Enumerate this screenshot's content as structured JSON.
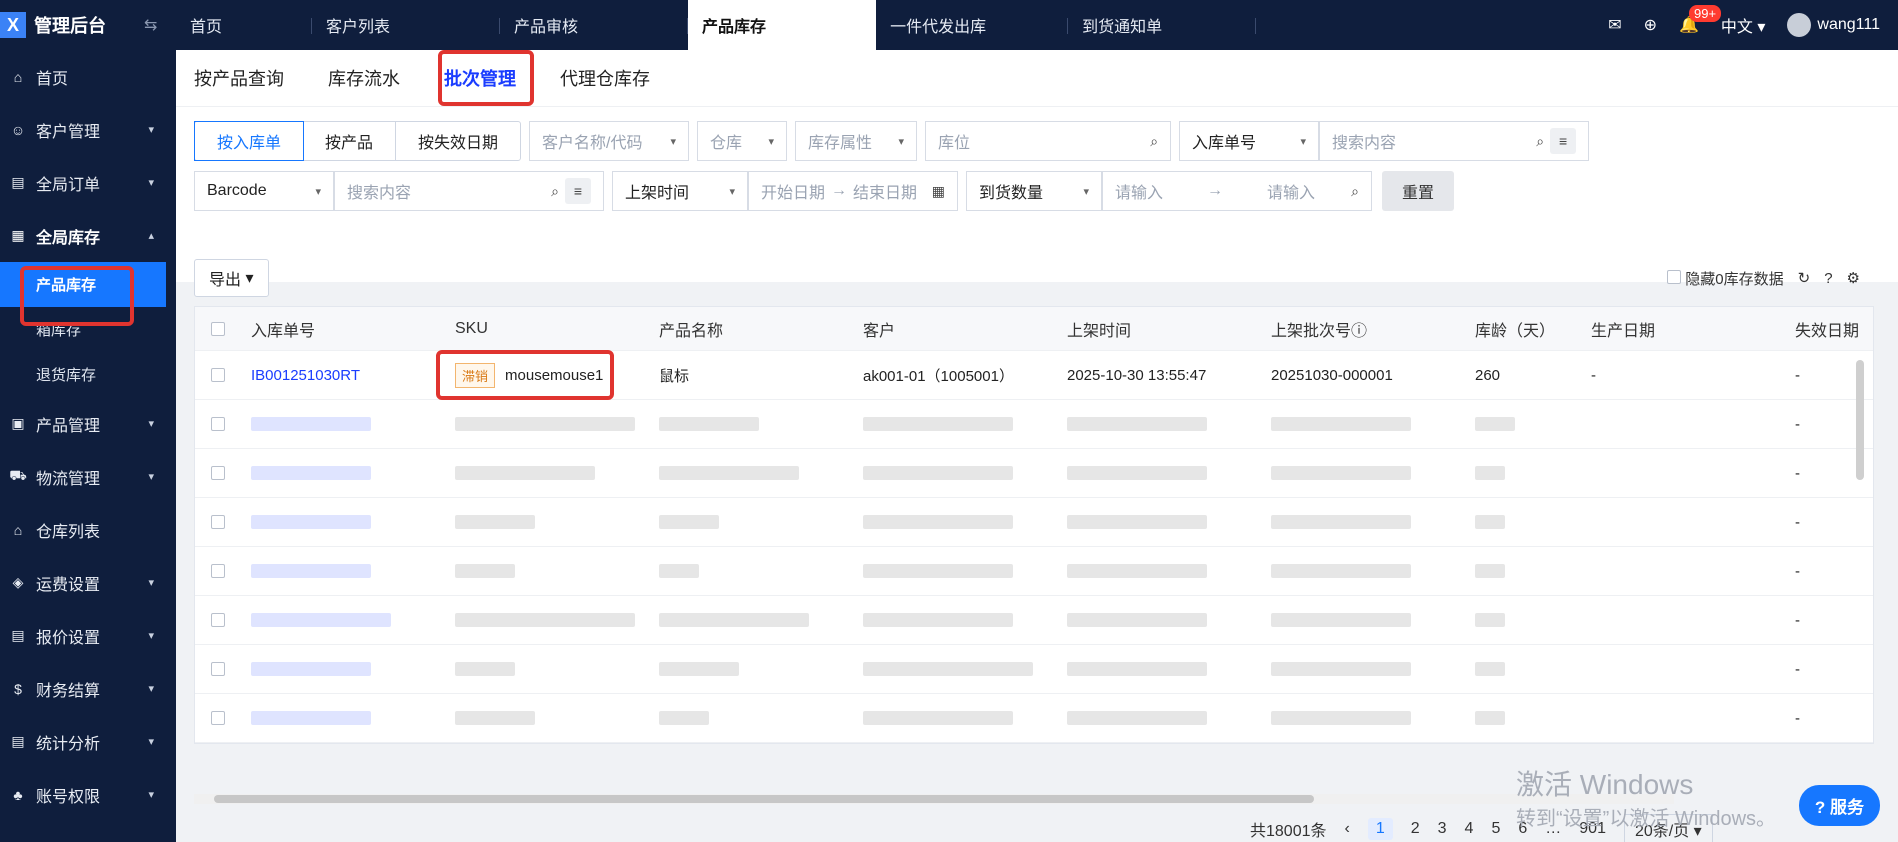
{
  "brand": {
    "title": "管理后台",
    "logo_letter": "X"
  },
  "sidebar": {
    "items": [
      {
        "label": "首页",
        "icon": "home-icon"
      },
      {
        "label": "客户管理",
        "icon": "user-icon"
      },
      {
        "label": "全局订单",
        "icon": "order-icon"
      },
      {
        "label": "全局库存",
        "icon": "warehouse-icon"
      }
    ],
    "sub_items": [
      "产品库存",
      "箱库存",
      "退货库存"
    ],
    "items_after": [
      {
        "label": "产品管理",
        "icon": "box-icon"
      },
      {
        "label": "物流管理",
        "icon": "truck-icon"
      },
      {
        "label": "仓库列表",
        "icon": "building-icon"
      },
      {
        "label": "运费设置",
        "icon": "tag-icon"
      },
      {
        "label": "报价设置",
        "icon": "doc-icon"
      },
      {
        "label": "财务结算",
        "icon": "coin-icon"
      },
      {
        "label": "统计分析",
        "icon": "chart-icon"
      },
      {
        "label": "账号权限",
        "icon": "org-icon"
      }
    ]
  },
  "topbar": {
    "tabs": [
      "首页",
      "客户列表",
      "产品审核",
      "产品库存",
      "一件代发出库",
      "到货通知单"
    ],
    "active_tab": "产品库存",
    "badge": "99+",
    "lang": "中文",
    "user": "wang111"
  },
  "subtabs": [
    "按产品查询",
    "库存流水",
    "批次管理",
    "代理仓库存"
  ],
  "filters": {
    "seg": [
      "按入库单",
      "按产品",
      "按失效日期"
    ],
    "customer_ph": "客户名称/代码",
    "warehouse_ph": "仓库",
    "stock_attr_ph": "库存属性",
    "location_ph": "库位",
    "inbound_sel": "入库单号",
    "search_ph": "搜索内容",
    "barcode_sel": "Barcode",
    "shelf_time_sel": "上架时间",
    "start_date_ph": "开始日期",
    "end_date_ph": "结束日期",
    "arrival_qty_sel": "到货数量",
    "input_ph": "请输入",
    "reset": "重置"
  },
  "toolbar": {
    "export": "导出",
    "hide_zero": "隐藏0库存数据"
  },
  "table": {
    "headers": [
      "入库单号",
      "SKU",
      "产品名称",
      "客户",
      "上架时间",
      "上架批次号",
      "库龄（天）",
      "生产日期",
      "失效日期"
    ],
    "rows": [
      {
        "inbound_no": "IB001251030RT",
        "tag": "滞销",
        "sku": "mousemouse1",
        "product": "鼠标",
        "customer": "ak001-01（1005001）",
        "shelf_time": "2025-10-30 13:55:47",
        "batch_no": "20251030-000001",
        "age": "260",
        "produce": "-",
        "expire": "-"
      }
    ],
    "blurred_expire": [
      "-",
      "-",
      "-",
      "-",
      "-",
      "-",
      "-"
    ]
  },
  "pager": {
    "total": "共18001条",
    "pages": [
      "1",
      "2",
      "3",
      "4",
      "5",
      "6"
    ],
    "last": "901",
    "per_page": "20条/页"
  },
  "watermark": {
    "line1": "激活 Windows",
    "line2": "转到“设置”以激活 Windows。"
  },
  "service": "服务"
}
